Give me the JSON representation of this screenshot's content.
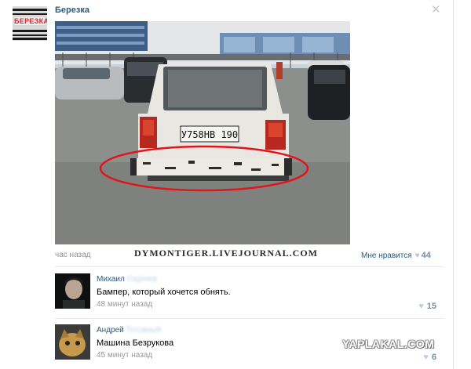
{
  "post": {
    "group_name": "Березка",
    "group_logo_text": "БЕРЕЗКА",
    "time": "час назад",
    "like_label": "Мне нравится",
    "like_count": "44",
    "photo_plate": "У758НВ 190",
    "photo_sign": "ВЕРЕЗКА"
  },
  "watermarks": {
    "livejournal": "DYMONTIGER.LIVEJOURNAL.COM",
    "yaplakal": "YAPLAKAL.COM"
  },
  "comments": [
    {
      "author_first": "Михаил",
      "author_last": "Сергеев",
      "text": "Бампер, который хочется обнять.",
      "time": "48 минут назад",
      "likes": "15"
    },
    {
      "author_first": "Андрей",
      "author_last": "Тотовный",
      "text": "Машина Безрукова",
      "time": "45 минут назад",
      "likes": "6"
    }
  ],
  "colors": {
    "link": "#2b587a",
    "muted": "#909090",
    "highlight_ellipse": "#e0151b"
  }
}
